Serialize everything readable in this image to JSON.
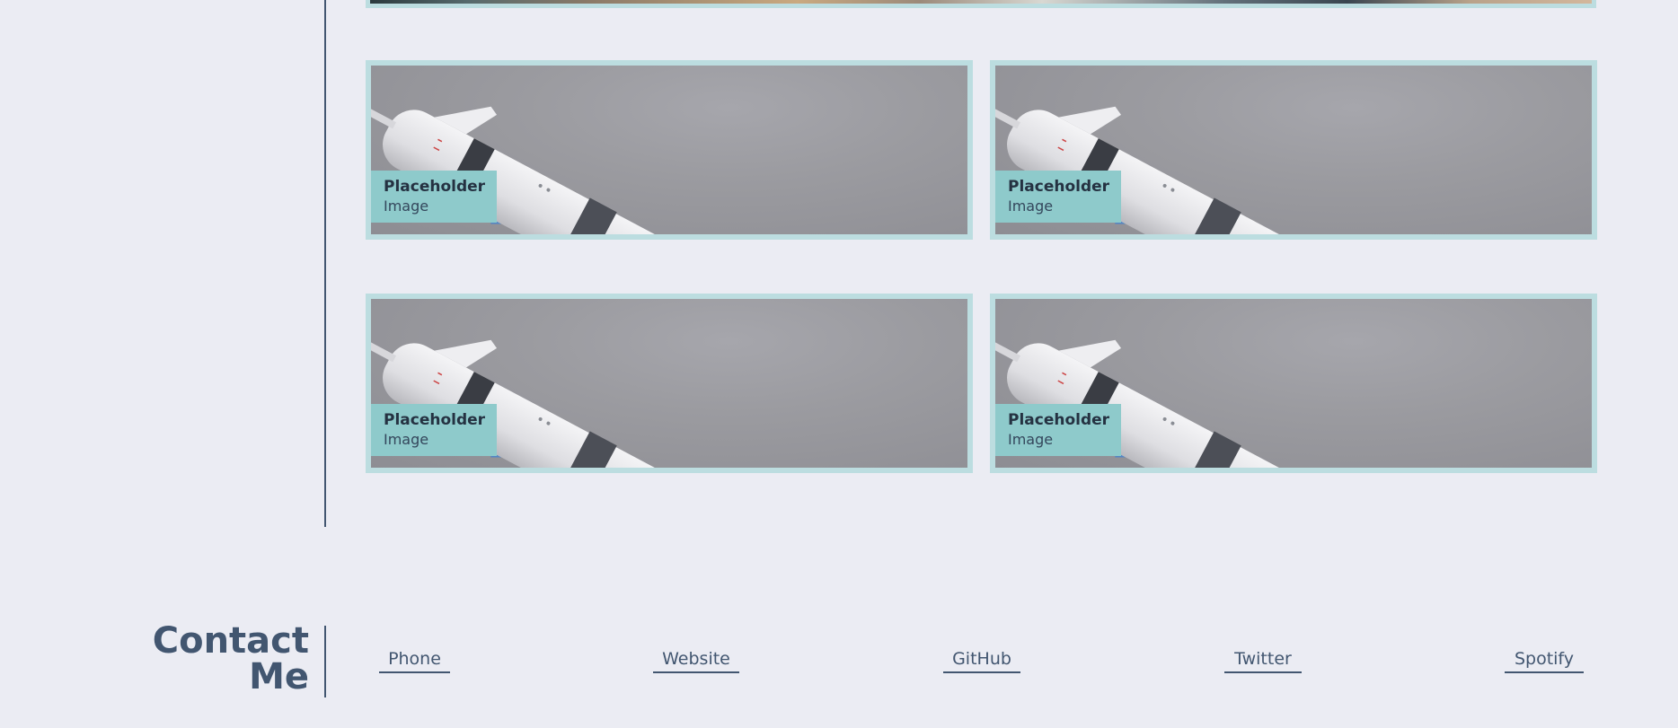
{
  "gallery": {
    "cards": [
      {
        "title": "Placeholder",
        "subtitle": "Image",
        "image_icon": "rocket-model-photo"
      },
      {
        "title": "Placeholder",
        "subtitle": "Image",
        "image_icon": "rocket-model-photo"
      },
      {
        "title": "Placeholder",
        "subtitle": "Image",
        "image_icon": "rocket-model-photo"
      },
      {
        "title": "Placeholder",
        "subtitle": "Image",
        "image_icon": "rocket-model-photo"
      }
    ]
  },
  "contact": {
    "heading_line1": "Contact",
    "heading_line2": "Me",
    "links": {
      "phone": "Phone",
      "website": "Website",
      "github": "GitHub",
      "twitter": "Twitter",
      "spotify": "Spotify"
    }
  },
  "colors": {
    "background": "#ebecf3",
    "accent": "#425670",
    "card_border": "#bcdde0",
    "caption_bg": "#8ecacb"
  }
}
